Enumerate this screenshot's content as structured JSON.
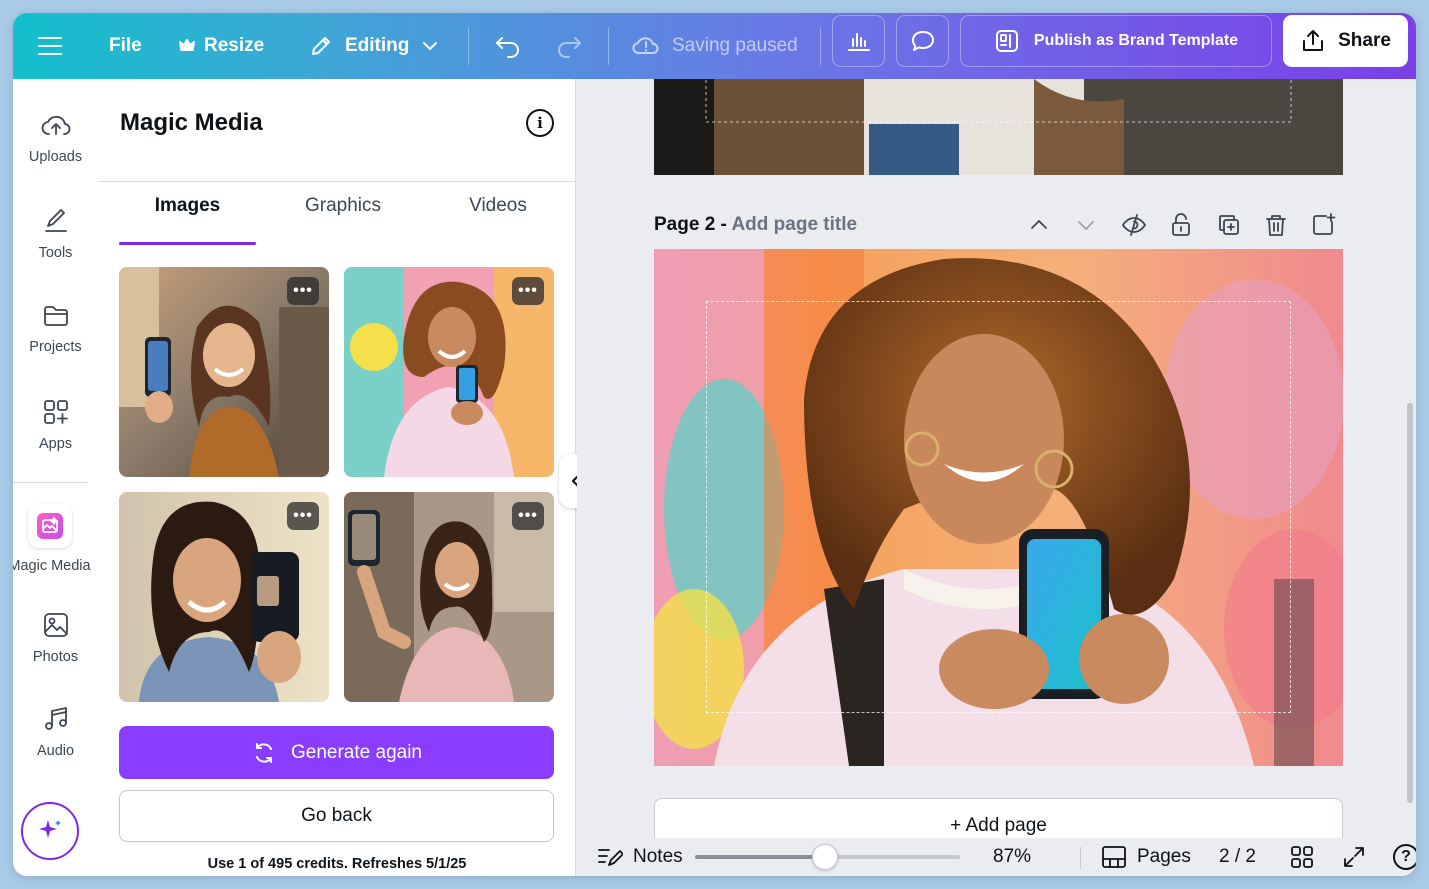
{
  "topbar": {
    "file_label": "File",
    "resize_label": "Resize",
    "editing_label": "Editing",
    "saving_status": "Saving paused",
    "publish_label": "Publish as Brand Template",
    "share_label": "Share"
  },
  "rail": {
    "uploads": "Uploads",
    "tools": "Tools",
    "projects": "Projects",
    "apps": "Apps",
    "magic_media": "Magic Media",
    "photos": "Photos",
    "audio": "Audio"
  },
  "panel": {
    "title": "Magic Media",
    "tabs": [
      "Images",
      "Graphics",
      "Videos"
    ],
    "active_tab": "Images",
    "more_glyph": "•••",
    "generate_again": "Generate again",
    "go_back": "Go back",
    "credits": "Use 1 of 495 credits. Refreshes 5/1/25"
  },
  "canvas": {
    "page_label": "Page 2 -",
    "page_title_placeholder": "Add page title",
    "add_page": "+  Add page"
  },
  "bottombar": {
    "notes": "Notes",
    "zoom": "87%",
    "zoom_fraction": 0.49,
    "pages": "Pages",
    "page_count": "2 / 2",
    "help_glyph": "?"
  },
  "colors": {
    "accent": "#8b3dff",
    "tab_underline": "#7d2ae8"
  }
}
